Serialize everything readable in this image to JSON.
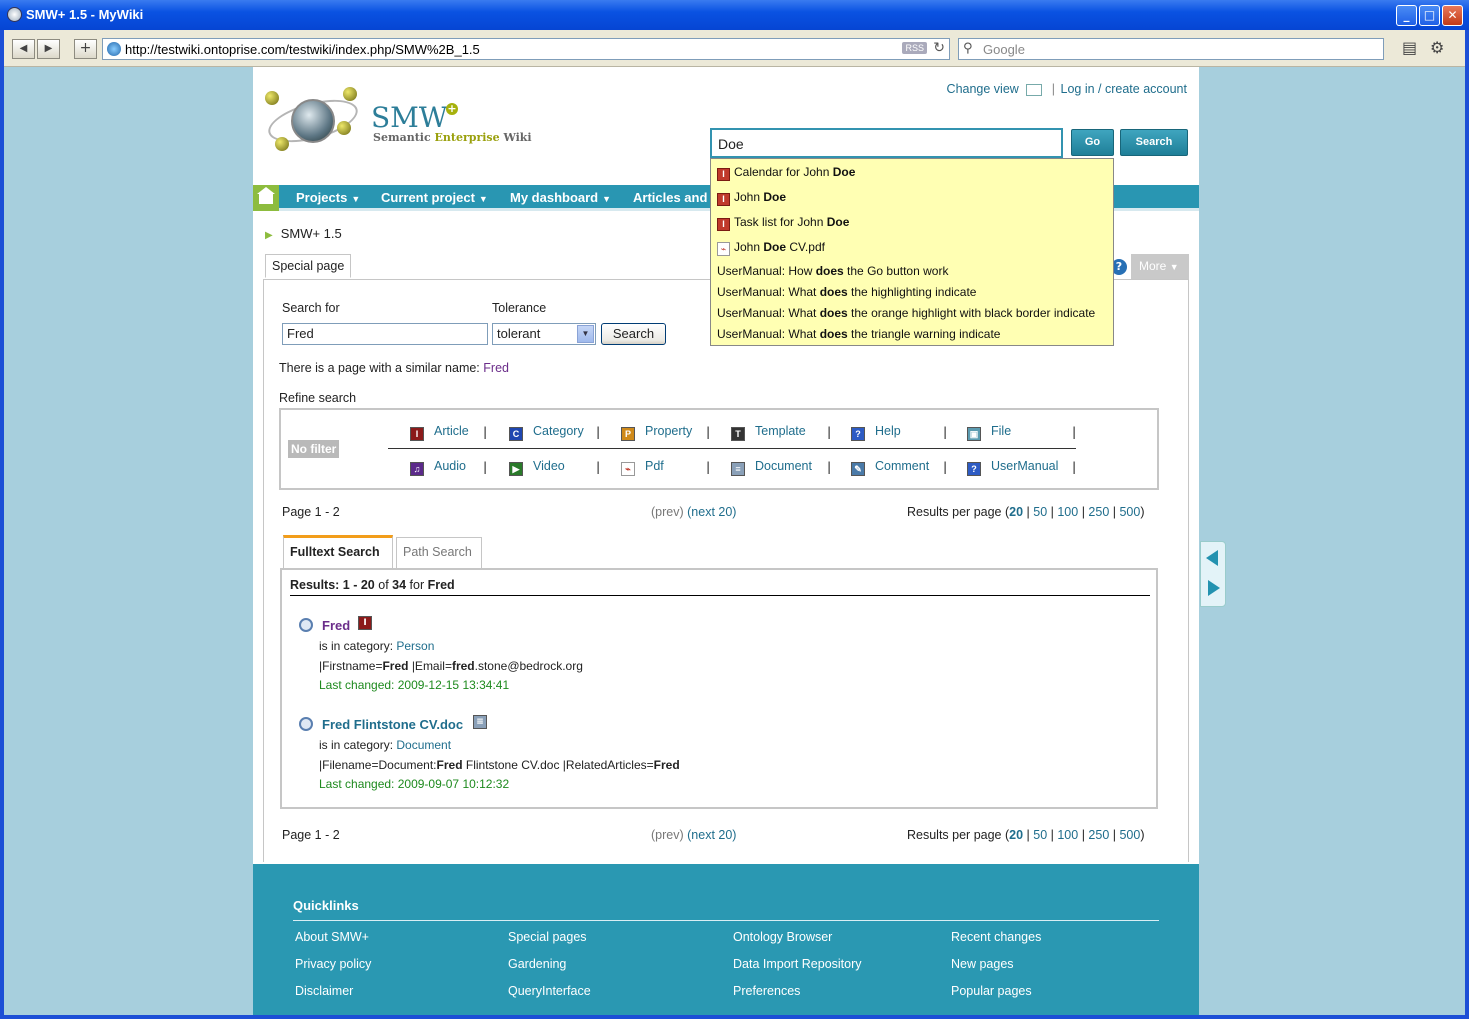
{
  "window": {
    "title": "SMW+ 1.5 - MyWiki",
    "minimize": "_",
    "maximize": "□",
    "close": "✕"
  },
  "browser": {
    "url": "http://testwiki.ontoprise.com/testwiki/index.php/SMW%2B_1.5",
    "rss": "RSS",
    "search_placeholder": "Google"
  },
  "logo": {
    "name": "SMW",
    "plus": "+",
    "sub_a": "Semantic ",
    "sub_b": "Enterprise",
    "sub_c": " Wiki"
  },
  "header": {
    "change_view": "Change view",
    "login": "Log in / create account",
    "sep": "|"
  },
  "search": {
    "value": "Doe",
    "go": "Go",
    "search": "Search"
  },
  "menu": {
    "projects": "Projects",
    "current_project": "Current project",
    "my_dashboard": "My dashboard",
    "articles": "Articles and"
  },
  "breadcrumb": "SMW+ 1.5",
  "tabs": {
    "special_page": "Special page",
    "more": "More"
  },
  "form": {
    "search_for_label": "Search for",
    "search_for_value": "Fred",
    "tolerance_label": "Tolerance",
    "tolerance_value": "tolerant",
    "search_button": "Search",
    "similar_text": "There is a page with a similar name: ",
    "similar_link": "Fred",
    "refine": "Refine search"
  },
  "filters": {
    "no_filter": "No filter",
    "row1": [
      "Article",
      "Category",
      "Property",
      "Template",
      "Help",
      "File"
    ],
    "row2": [
      "Audio",
      "Video",
      "Pdf",
      "Document",
      "Comment",
      "UserManual"
    ]
  },
  "pager": {
    "page": "Page 1 - 2",
    "prev": "(prev)",
    "next": "(next 20)",
    "rpp_label": "Results per page (",
    "rpp": [
      "20",
      "50",
      "100",
      "250",
      "500"
    ],
    "close": ")"
  },
  "results_tabs": {
    "fulltext": "Fulltext Search",
    "path": "Path Search"
  },
  "results": {
    "head_a": "Results: ",
    "range": "1 - 20",
    "of": " of ",
    "total": "34",
    "for": " for ",
    "query": "Fred",
    "items": [
      {
        "title": "Fred",
        "cat_label": "is in category: ",
        "category": "Person",
        "snippet_a": "|Firstname=",
        "snippet_b": "Fred",
        "snippet_c": " |Email=",
        "snippet_d": "fred",
        "snippet_e": ".stone@bedrock.org",
        "changed": "Last changed: 2009-12-15 13:34:41"
      },
      {
        "title": "Fred Flintstone CV.doc",
        "cat_label": "is in category: ",
        "category": "Document",
        "snippet_a": "|Filename=Document:",
        "snippet_b": "Fred",
        "snippet_c": " Flintstone CV.doc |RelatedArticles=",
        "snippet_d": "Fred",
        "snippet_e": "",
        "changed": "Last changed: 2009-09-07 10:12:32"
      }
    ]
  },
  "autocomplete": [
    {
      "pre": "Calendar for John ",
      "bold": "Doe",
      "post": ""
    },
    {
      "pre": "John ",
      "bold": "Doe",
      "post": ""
    },
    {
      "pre": "Task list for John ",
      "bold": "Doe",
      "post": ""
    },
    {
      "pre": "John ",
      "bold": "Doe",
      "post": " CV.pdf"
    },
    {
      "pre": "UserManual: How ",
      "bold": "does",
      "post": " the Go button work"
    },
    {
      "pre": "UserManual: What ",
      "bold": "does",
      "post": " the highlighting indicate"
    },
    {
      "pre": "UserManual: What ",
      "bold": "does",
      "post": " the orange highlight with black border indicate"
    },
    {
      "pre": "UserManual: What ",
      "bold": "does",
      "post": " the triangle warning indicate"
    }
  ],
  "footer": {
    "title": "Quicklinks",
    "col1": [
      "About SMW+",
      "Privacy policy",
      "Disclaimer"
    ],
    "col2": [
      "Special pages",
      "Gardening",
      "QueryInterface"
    ],
    "col3": [
      "Ontology Browser",
      "Data Import Repository",
      "Preferences"
    ],
    "col4": [
      "Recent changes",
      "New pages",
      "Popular pages"
    ]
  }
}
